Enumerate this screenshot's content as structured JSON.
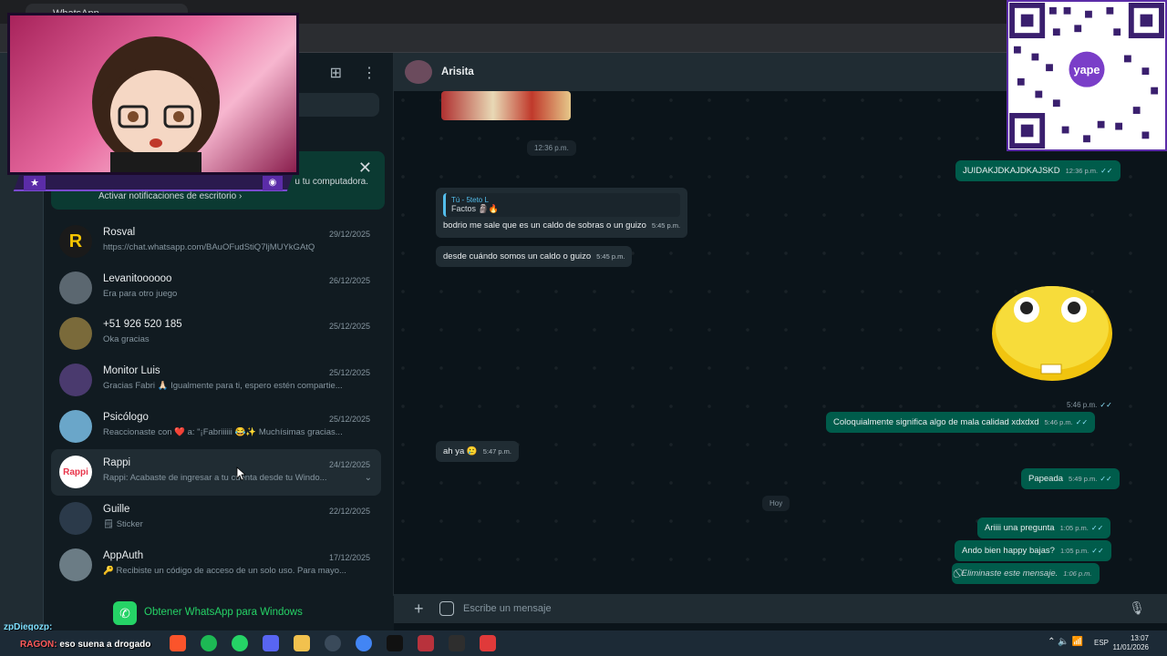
{
  "browser": {
    "tab_title": "WhatsApp"
  },
  "sidebar": {
    "notification": {
      "subtitle": "u tu computadora.",
      "link": "Activar notificaciones de escritorio ›"
    },
    "chats": [
      {
        "name": "Rosval",
        "date": "29/12/2025",
        "preview": "https://chat.whatsapp.com/BAuOFudStiQ7ljMUYkGAtQ",
        "avatar_color": "#1a1a1a",
        "avatar_text": "R"
      },
      {
        "name": "Levanitoooooo",
        "date": "26/12/2025",
        "preview": "Era para otro juego",
        "avatar_color": "#5b6770",
        "avatar_text": ""
      },
      {
        "name": "+51 926 520 185",
        "date": "25/12/2025",
        "preview": "Oka gracias",
        "avatar_color": "#7a6a3a",
        "avatar_text": ""
      },
      {
        "name": "Monitor Luis",
        "date": "25/12/2025",
        "preview": "Gracias Fabri 🙏🏻 Igualmente para ti, espero estén compartie...",
        "avatar_color": "#4a3a6e",
        "avatar_text": ""
      },
      {
        "name": "Psicólogo",
        "date": "25/12/2025",
        "preview": "Reaccionaste con ❤️ a: \"¡Fabriiiiii 😂✨ Muchísimas gracias...",
        "avatar_color": "#6aa6c9",
        "avatar_text": ""
      },
      {
        "name": "Rappi",
        "date": "24/12/2025",
        "preview": "Rappi: Acabaste de ingresar a tu cuenta desde tu Windo...",
        "avatar_color": "#ffffff",
        "avatar_text": "Rappi"
      },
      {
        "name": "Guille",
        "date": "22/12/2025",
        "preview": "🗒 Sticker",
        "avatar_color": "#2b3a4a",
        "avatar_text": ""
      },
      {
        "name": "AppAuth",
        "date": "17/12/2025",
        "preview": "🔑 Recibiste un código de acceso de un solo uso. Para mayo...",
        "avatar_color": "#6b7c85",
        "avatar_text": ""
      }
    ],
    "get_app": "Obtener WhatsApp para Windows"
  },
  "conversation": {
    "contact": "Arisita",
    "messages": [
      {
        "dir": "in",
        "kind": "time",
        "text": "12:36 p.m."
      },
      {
        "dir": "out",
        "text": "JUIDAKJDKAJDKAJSKD",
        "time": "12:36 p.m."
      },
      {
        "dir": "in",
        "quote_name": "Tú - 5teto L",
        "quote_text": "Factos 🗿🔥",
        "text": "bodrio me sale que es un caldo de sobras o un guizo",
        "time": "5:45 p.m."
      },
      {
        "dir": "in",
        "text": "desde cuándo somos un caldo o guizo",
        "time": "5:45 p.m."
      },
      {
        "dir": "out",
        "kind": "sticker-time",
        "time": "5:46 p.m."
      },
      {
        "dir": "out",
        "text": "Coloquialmente significa algo de mala calidad xdxdxd",
        "time": "5:46 p.m."
      },
      {
        "dir": "in",
        "text": "ah ya 🥲",
        "time": "5:47 p.m."
      },
      {
        "dir": "out",
        "text": "Papeada",
        "time": "5:49 p.m."
      },
      {
        "dir": "out",
        "text": "Ariiii una pregunta",
        "time": "1:05 p.m."
      },
      {
        "dir": "out",
        "text": "Ando bien happy bajas?",
        "time": "1:05 p.m."
      },
      {
        "dir": "out",
        "text": "Eliminaste este mensaje.",
        "time": "1:06 p.m."
      }
    ],
    "day_divider": "Hoy",
    "input_placeholder": "Escribe un mensaje"
  },
  "overlay": {
    "qr_brand": "yape",
    "stream_chat": [
      {
        "user": "zpDiegozp:",
        "text": ""
      },
      {
        "user": "RAGON:",
        "text": "eso suena a drogado"
      }
    ]
  },
  "taskbar": {
    "lang": "ESP",
    "time": "13:07",
    "date": "11/01/2026"
  }
}
